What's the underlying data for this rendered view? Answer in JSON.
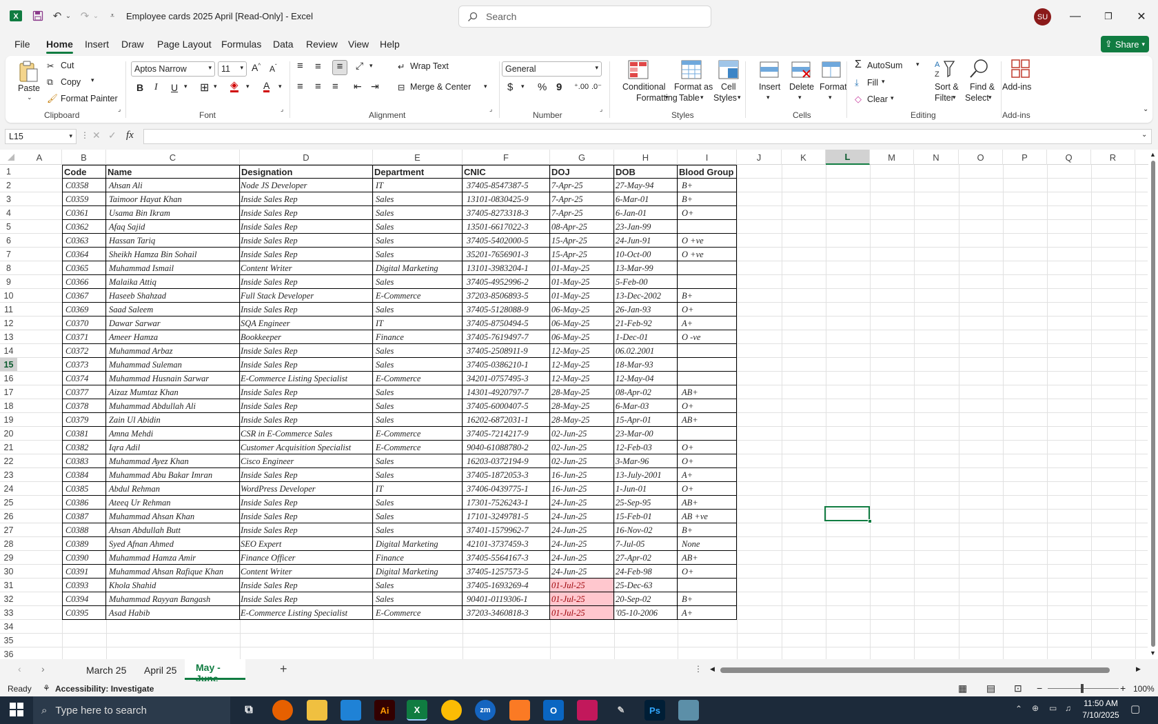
{
  "window": {
    "title": "Employee cards 2025 April  [Read-Only]  -  Excel",
    "search_placeholder": "Search",
    "user_initials": "SU"
  },
  "menu": [
    "File",
    "Home",
    "Insert",
    "Draw",
    "Page Layout",
    "Formulas",
    "Data",
    "Review",
    "View",
    "Help"
  ],
  "share_label": "Share",
  "ribbon": {
    "clipboard": {
      "paste": "Paste",
      "cut": "Cut",
      "copy": "Copy",
      "format_painter": "Format Painter",
      "group": "Clipboard"
    },
    "font": {
      "name": "Aptos Narrow",
      "size": "11",
      "bold": "B",
      "italic": "I",
      "underline": "U",
      "group": "Font"
    },
    "alignment": {
      "wrap": "Wrap Text",
      "merge": "Merge & Center",
      "group": "Alignment"
    },
    "number": {
      "format": "General",
      "currency": "$",
      "percent": "%",
      "comma": "9",
      "group": "Number"
    },
    "styles": {
      "cond_l1": "Conditional",
      "cond_l2": "Formatting",
      "fmt_l1": "Format as",
      "fmt_l2": "Table",
      "cell_l1": "Cell",
      "cell_l2": "Styles",
      "group": "Styles"
    },
    "cells": {
      "insert": "Insert",
      "delete": "Delete",
      "format": "Format",
      "group": "Cells"
    },
    "editing": {
      "autosum": "AutoSum",
      "fill": "Fill",
      "clear": "Clear",
      "sort_l1": "Sort &",
      "sort_l2": "Filter",
      "find_l1": "Find &",
      "find_l2": "Select",
      "group": "Editing"
    },
    "addins": {
      "label": "Add-ins",
      "group": "Add-ins"
    }
  },
  "formula_bar": {
    "name_box": "L15",
    "fx": "fx",
    "content": ""
  },
  "columns": [
    "A",
    "B",
    "C",
    "D",
    "E",
    "F",
    "G",
    "H",
    "I",
    "J",
    "K",
    "L",
    "M",
    "N",
    "O",
    "P",
    "Q",
    "R"
  ],
  "rows": [
    "1",
    "2",
    "3",
    "4",
    "5",
    "6",
    "7",
    "8",
    "9",
    "10",
    "11",
    "12",
    "13",
    "14",
    "15",
    "16",
    "17",
    "18",
    "19",
    "20",
    "21",
    "22",
    "23",
    "24",
    "25",
    "26",
    "27",
    "28",
    "29",
    "30",
    "31",
    "32",
    "33",
    "34",
    "35",
    "36"
  ],
  "table": {
    "headers": [
      "Code",
      "Name",
      "Designation",
      "Department",
      "CNIC",
      "DOJ",
      "DOB",
      "Blood Group"
    ],
    "rows": [
      [
        "C0358",
        "Ahsan Ali",
        "Node JS Developer",
        "IT",
        "37405-8547387-5",
        "7-Apr-25",
        "27-May-94",
        "B+"
      ],
      [
        "C0359",
        "Taimoor Hayat Khan",
        "Inside Sales Rep",
        "Sales",
        "13101-0830425-9",
        "7-Apr-25",
        "6-Mar-01",
        "B+"
      ],
      [
        "C0361",
        "Usama Bin Ikram",
        "Inside Sales Rep",
        "Sales",
        "37405-8273318-3",
        "7-Apr-25",
        "6-Jan-01",
        "O+"
      ],
      [
        "C0362",
        "Afaq Sajid",
        "Inside Sales Rep",
        "Sales",
        "13501-6617022-3",
        "08-Apr-25",
        "23-Jan-99",
        ""
      ],
      [
        "C0363",
        "Hassan Tariq",
        "Inside Sales Rep",
        "Sales",
        "37405-5402000-5",
        "15-Apr-25",
        "24-Jun-91",
        "O +ve"
      ],
      [
        "C0364",
        "Sheikh Hamza Bin Sohail",
        "Inside Sales Rep",
        "Sales",
        "35201-7656901-3",
        "15-Apr-25",
        "10-Oct-00",
        "O +ve"
      ],
      [
        "C0365",
        "Muhammad Ismail",
        "Content Writer",
        "Digital Marketing",
        "13101-3983204-1",
        "01-May-25",
        "13-Mar-99",
        ""
      ],
      [
        "C0366",
        "Malaika Attiq",
        "Inside Sales Rep",
        "Sales",
        "37405-4952996-2",
        "01-May-25",
        "5-Feb-00",
        ""
      ],
      [
        "C0367",
        "Haseeb Shahzad",
        "Full Stack Developer",
        "E-Commerce",
        "37203-8506893-5",
        "01-May-25",
        "13-Dec-2002",
        "B+"
      ],
      [
        "C0369",
        "Saad Saleem",
        "Inside Sales Rep",
        "Sales",
        "37405-5128088-9",
        "06-May-25",
        "26-Jan-93",
        "O+"
      ],
      [
        "C0370",
        "Dawar Sarwar",
        "SQA Engineer",
        "IT",
        "37405-8750494-5",
        "06-May-25",
        "21-Feb-92",
        "A+"
      ],
      [
        "C0371",
        "Ameer Hamza",
        "Bookkeeper",
        "Finance",
        "37405-7619497-7",
        "06-May-25",
        "1-Dec-01",
        "O -ve"
      ],
      [
        "C0372",
        "Muhammad Arbaz",
        "Inside Sales Rep",
        "Sales",
        "37405-2508911-9",
        "12-May-25",
        "06.02.2001",
        ""
      ],
      [
        "C0373",
        "Muhammad Suleman",
        "Inside Sales Rep",
        "Sales",
        "37405-0386210-1",
        "12-May-25",
        "18-Mar-93",
        ""
      ],
      [
        "C0374",
        "Muhammad Husnain Sarwar",
        "E-Commerce Listing Specialist",
        "E-Commerce",
        "34201-0757495-3",
        "12-May-25",
        "12-May-04",
        ""
      ],
      [
        "C0377",
        "Aizaz Mumtaz Khan",
        "Inside Sales Rep",
        "Sales",
        "14301-4920797-7",
        "28-May-25",
        "08-Apr-02",
        "AB+"
      ],
      [
        "C0378",
        "Muhammad Abdullah Ali",
        "Inside Sales Rep",
        "Sales",
        "37405-6000407-5",
        "28-May-25",
        "6-Mar-03",
        "O+"
      ],
      [
        "C0379",
        "Zain Ul Abidin",
        "Inside Sales Rep",
        "Sales",
        "16202-6872031-1",
        "28-May-25",
        "15-Apr-01",
        "AB+"
      ],
      [
        "C0381",
        "Amna Mehdi",
        "CSR in E-Commerce Sales",
        "E-Commerce",
        "37405-7214217-9",
        "02-Jun-25",
        "23-Mar-00",
        ""
      ],
      [
        "C0382",
        "Iqra Adil",
        "Customer Acquisition Specialist",
        "E-Commerce",
        "9040-61088780-2",
        "02-Jun-25",
        "12-Feb-03",
        "O+"
      ],
      [
        "C0383",
        "Muhammad Ayez Khan",
        "Cisco Engineer",
        "Sales",
        "16203-0372194-9",
        "02-Jun-25",
        "3-Mar-96",
        "O+"
      ],
      [
        "C0384",
        "Muhammad Abu Bakar Imran",
        "Inside Sales Rep",
        "Sales",
        "37405-1872053-3",
        "16-Jun-25",
        "13-July-2001",
        "A+"
      ],
      [
        "C0385",
        "Abdul Rehman",
        "WordPress Developer",
        "IT",
        "37406-0439775-1",
        "16-Jun-25",
        "1-Jun-01",
        "O+"
      ],
      [
        "C0386",
        "Ateeq Ur Rehman",
        "Inside Sales Rep",
        "Sales",
        "17301-7526243-1",
        "24-Jun-25",
        "25-Sep-95",
        "AB+"
      ],
      [
        "C0387",
        "Muhammad Ahsan Khan",
        "Inside Sales Rep",
        "Sales",
        "17101-3249781-5",
        "24-Jun-25",
        "15-Feb-01",
        "AB +ve"
      ],
      [
        "C0388",
        "Ahsan Abdullah Butt",
        "Inside Sales Rep",
        "Sales",
        "37401-1579962-7",
        "24-Jun-25",
        "16-Nov-02",
        "B+"
      ],
      [
        "C0389",
        "Syed Afnan Ahmed",
        "SEO Expert",
        "Digital Marketing",
        "42101-3737459-3",
        "24-Jun-25",
        "7-Jul-05",
        "None"
      ],
      [
        "C0390",
        "Muhammad Hamza Amir",
        "Finance Officer",
        "Finance",
        "37405-5564167-3",
        "24-Jun-25",
        "27-Apr-02",
        "AB+"
      ],
      [
        "C0391",
        "Muhammad Ahsan Rafique Khan",
        "Content Writer",
        "Digital Marketing",
        "37405-1257573-5",
        "24-Jun-25",
        "24-Feb-98",
        "O+"
      ],
      [
        "C0393",
        "Khola Shahid",
        "Inside Sales Rep",
        "Sales",
        "37405-1693269-4",
        "01-Jul-25",
        "25-Dec-63",
        ""
      ],
      [
        "C0394",
        "Muhammad Rayyan Bangash",
        "Inside Sales Rep",
        "Sales",
        "90401-0119306-1",
        "01-Jul-25",
        "20-Sep-02",
        "B+"
      ],
      [
        "C0395",
        "Asad Habib",
        "E-Commerce Listing Specialist",
        "E-Commerce",
        "37203-3460818-3",
        "01-Jul-25",
        "'05-10-2006",
        "A+"
      ]
    ]
  },
  "sheet_tabs": [
    "March 25",
    "April 25",
    "May - June"
  ],
  "active_tab": "May - June",
  "status": {
    "ready": "Ready",
    "accessibility": "Accessibility: Investigate",
    "zoom": "100%"
  },
  "taskbar": {
    "search_placeholder": "Type here to search",
    "time": "11:50 AM",
    "date": "7/10/2025"
  },
  "colors": {
    "accent": "#107c41",
    "highlight_fill": "#ffc7ce",
    "highlight_text": "#9c0006"
  }
}
